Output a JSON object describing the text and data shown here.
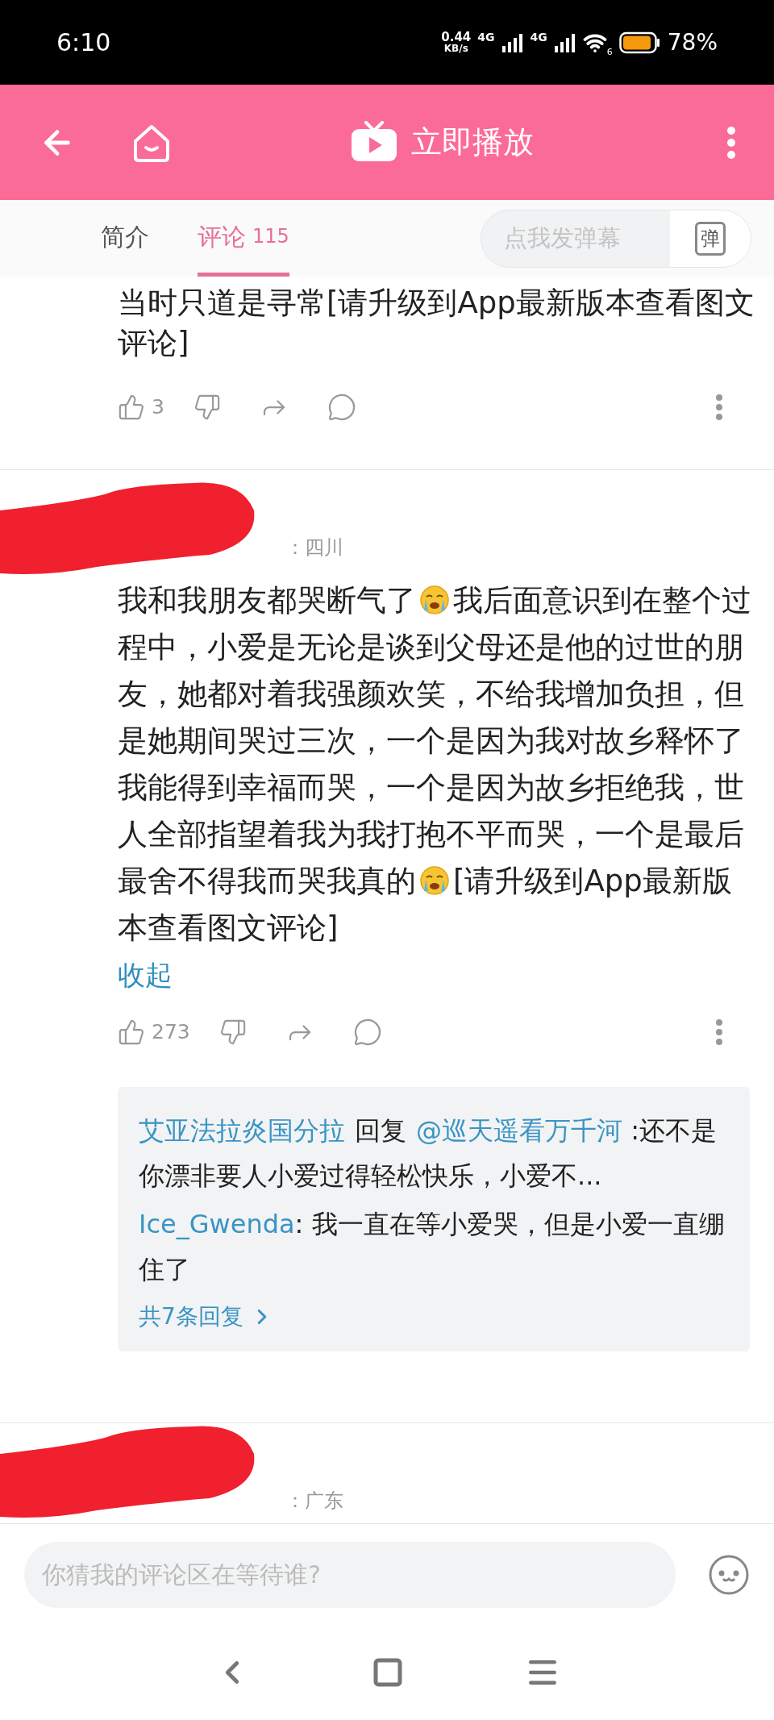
{
  "status_bar": {
    "time": "6:10",
    "speed": "0.44",
    "speed_unit": "KB/s",
    "network_1": "4G",
    "network_2": "4G",
    "wifi_label": "6",
    "battery": "78%"
  },
  "header": {
    "title": "立即播放"
  },
  "tabs": [
    {
      "label": "简介",
      "selected": false
    },
    {
      "label": "评论",
      "count": "115",
      "selected": true
    }
  ],
  "danmaku": {
    "placeholder": "点我发弹幕",
    "button": "弹"
  },
  "comments": [
    {
      "body": [
        {
          "kind": "text",
          "text": "当时只道是寻常[请升级到App最新版本查看图文评论]"
        }
      ],
      "likes": "3"
    },
    {
      "redacted": true,
      "location": "：四川",
      "body": [
        {
          "kind": "text",
          "text": "我和我朋友都哭断气了"
        },
        {
          "kind": "emoji"
        },
        {
          "kind": "text",
          "text": "我后面意识到在整个过程中，小爱是无论是谈到父母还是他的过世的朋友，她都对着我强颜欢笑，不给我增加负担，但是她期间哭过三次，一个是因为我对故乡释怀了我能得到幸福而哭，一个是因为故乡拒绝我，世人全部指望着我为我打抱不平而哭，一个是最后最舍不得我而哭我真的"
        },
        {
          "kind": "emoji"
        },
        {
          "kind": "text",
          "text": "[请升级到App最新版本查看图文评论]"
        }
      ],
      "collapse": "收起",
      "likes": "273",
      "replies": {
        "items": [
          {
            "parts": [
              {
                "kind": "user",
                "text": "艾亚法拉炎国分拉"
              },
              {
                "kind": "keyword",
                "text": "回复"
              },
              {
                "kind": "user",
                "text": "@巡天遥看万千河"
              },
              {
                "kind": "plain",
                "text": " :还不是你漂非要人小爱过得轻松快乐，小爱不..."
              }
            ]
          },
          {
            "parts": [
              {
                "kind": "user",
                "text": "Ice_Gwenda"
              },
              {
                "kind": "plain",
                "text": ": 我一直在等小爱哭，但是小爱一直绷住了"
              }
            ]
          }
        ],
        "more": "共7条回复"
      }
    },
    {
      "redacted": true,
      "location": "：广东"
    }
  ],
  "comment_input": {
    "placeholder": "你猜我的评论区在等待谁?"
  }
}
